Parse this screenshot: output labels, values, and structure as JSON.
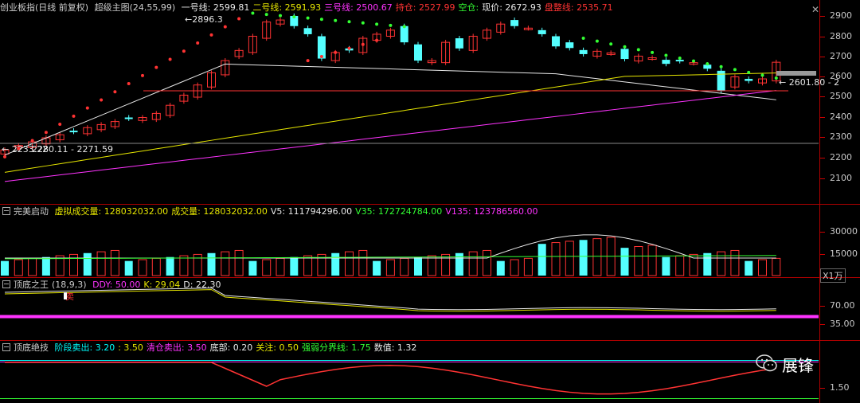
{
  "main": {
    "title": "创业板指(日线 前复权)",
    "indicator": "超级主图(24,55,99)",
    "legend": [
      {
        "label": "一号线: 2599.81",
        "color": "#e8e8e8"
      },
      {
        "label": "二号线: 2591.93",
        "color": "#e6e600"
      },
      {
        "label": "三号线: 2500.67",
        "color": "#ff33ff"
      },
      {
        "label": "持仓: 2527.99",
        "color": "#ff3333"
      },
      {
        "label": "空仓:",
        "color": "#33ff33"
      },
      {
        "label": "现价: 2672.93",
        "color": "#e8e8e8"
      },
      {
        "label": "盘整线: 2535.71",
        "color": "#ff3333"
      }
    ],
    "yticks": [
      "2900",
      "2800",
      "2700",
      "2600",
      "2500",
      "2400",
      "2300",
      "2200",
      "2100"
    ],
    "annotations": {
      "high": "2896.3",
      "low": "2233.22",
      "left_range": "2280.11 - 2271.59",
      "right_label": "2601.80 - 2"
    }
  },
  "vol": {
    "title": "完美启动",
    "legend": [
      {
        "label": "虚拟成交量: 128032032.00",
        "color": "#e6e600"
      },
      {
        "label": "成交量: 128032032.00",
        "color": "#e6e600"
      },
      {
        "label": "V5: 111794296.00",
        "color": "#e8e8e8"
      },
      {
        "label": "V35: 172724784.00",
        "color": "#33ff33"
      },
      {
        "label": "V135: 123786560.00",
        "color": "#ff33ff"
      }
    ],
    "yticks": [
      "30000",
      "15000"
    ],
    "unit": "X1万"
  },
  "kdj": {
    "title": "顶底之王",
    "params": "(18,9,3)",
    "legend": [
      {
        "label": "DDY: 50.00",
        "color": "#ff33ff"
      },
      {
        "label": "K: 29.04",
        "color": "#e6e600"
      },
      {
        "label": "D: 22.30",
        "color": "#e8e8e8"
      }
    ],
    "sell_label": "卖",
    "yticks": [
      "70.00",
      "35.00"
    ]
  },
  "jj": {
    "title": "顶底绝技",
    "legend": [
      {
        "label": "阶段卖出: 3.20",
        "color": "#00ffff"
      },
      {
        "label": ": 3.50",
        "color": "#e6e600"
      },
      {
        "label": "清仓卖出: 3.50",
        "color": "#ff33ff"
      },
      {
        "label": "底部: 0.20",
        "color": "#e8e8e8"
      },
      {
        "label": "关注: 0.50",
        "color": "#e6e600"
      },
      {
        "label": "强弱分界线: 1.75",
        "color": "#33ff33"
      },
      {
        "label": "数值: 1.32",
        "color": "#e8e8e8"
      }
    ],
    "yticks": [
      "1.50"
    ]
  },
  "watermark": "展锋",
  "colors": {
    "up": "#ff3333",
    "down": "#54ffff",
    "grid": "#b00000"
  }
}
